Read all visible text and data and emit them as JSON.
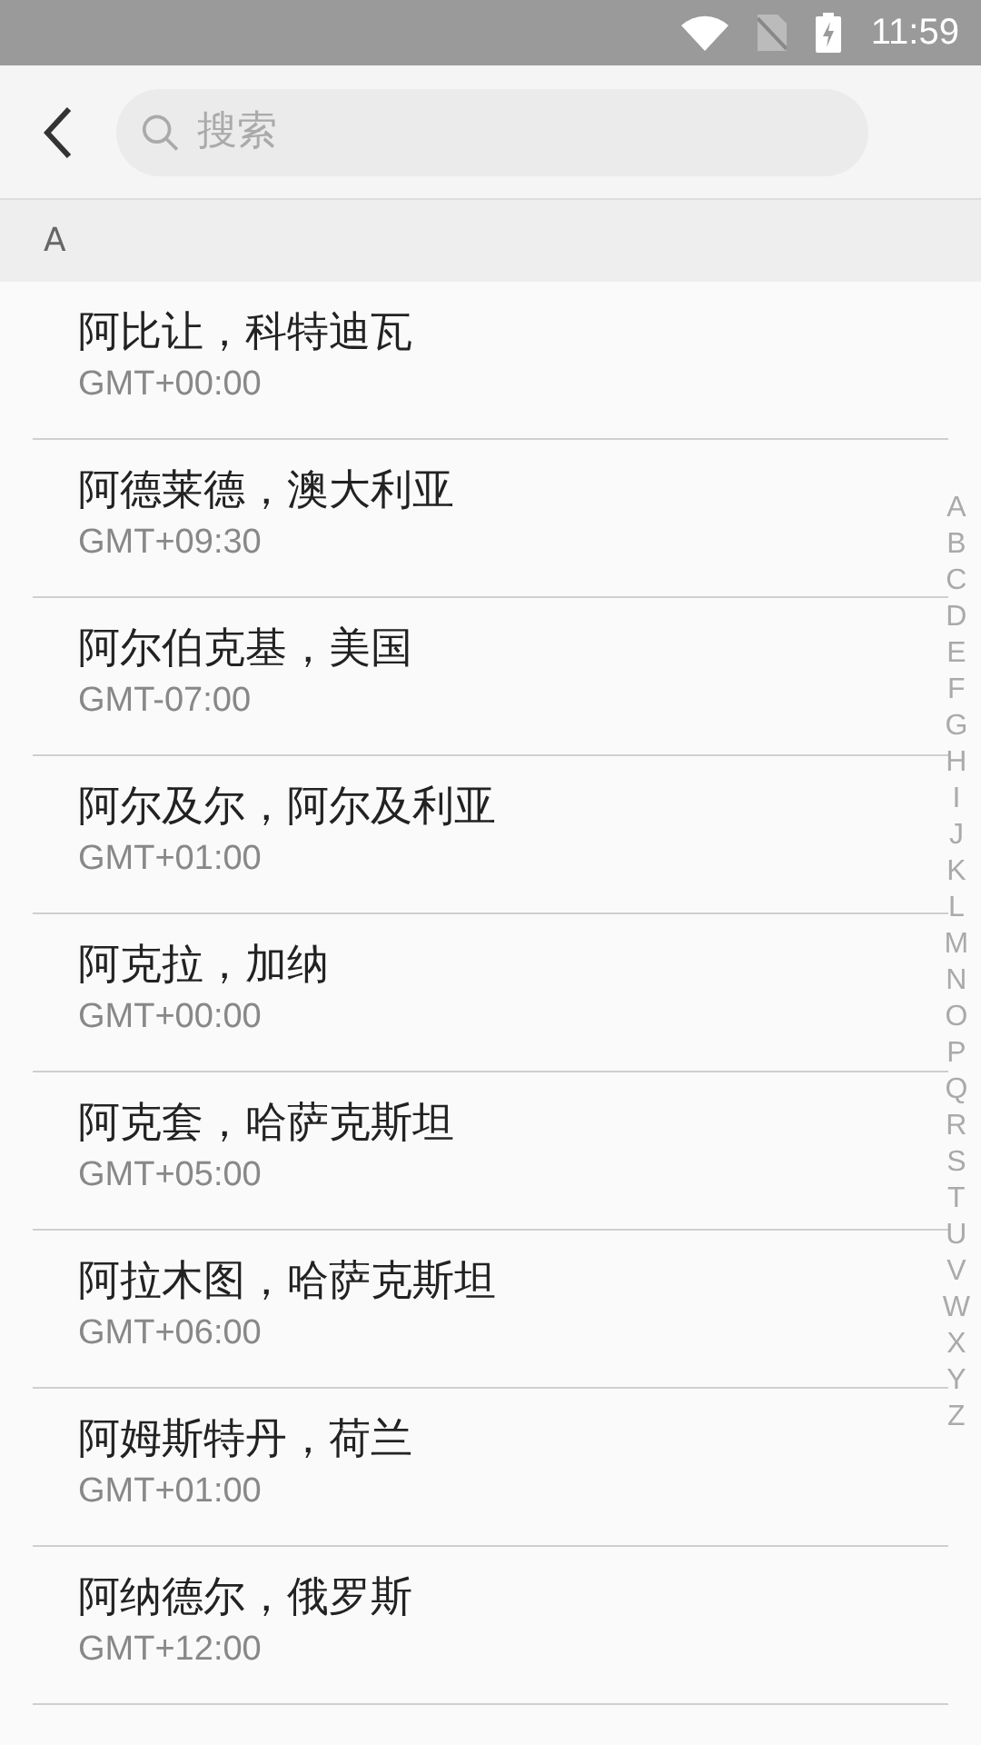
{
  "status_bar": {
    "time": "11:59"
  },
  "search": {
    "placeholder": "搜索"
  },
  "section": {
    "letter": "A"
  },
  "cities": [
    {
      "name": "阿比让，科特迪瓦",
      "offset": "GMT+00:00"
    },
    {
      "name": "阿德莱德，澳大利亚",
      "offset": "GMT+09:30"
    },
    {
      "name": "阿尔伯克基，美国",
      "offset": "GMT-07:00"
    },
    {
      "name": "阿尔及尔，阿尔及利亚",
      "offset": "GMT+01:00"
    },
    {
      "name": "阿克拉，加纳",
      "offset": "GMT+00:00"
    },
    {
      "name": "阿克套，哈萨克斯坦",
      "offset": "GMT+05:00"
    },
    {
      "name": "阿拉木图，哈萨克斯坦",
      "offset": "GMT+06:00"
    },
    {
      "name": "阿姆斯特丹，荷兰",
      "offset": "GMT+01:00"
    },
    {
      "name": "阿纳德尔，俄罗斯",
      "offset": "GMT+12:00"
    }
  ],
  "index_letters": [
    "A",
    "B",
    "C",
    "D",
    "E",
    "F",
    "G",
    "H",
    "I",
    "J",
    "K",
    "L",
    "M",
    "N",
    "O",
    "P",
    "Q",
    "R",
    "S",
    "T",
    "U",
    "V",
    "W",
    "X",
    "Y",
    "Z"
  ]
}
